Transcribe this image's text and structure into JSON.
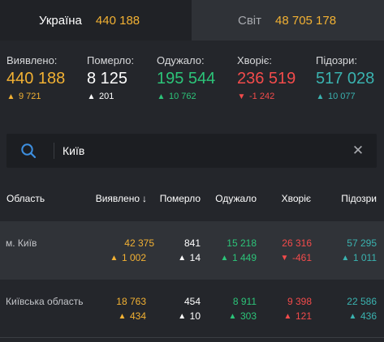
{
  "tabs": {
    "ukraine": {
      "label": "Україна",
      "value": "440 188"
    },
    "world": {
      "label": "Світ",
      "value": "48 705 178"
    }
  },
  "stats": [
    {
      "label": "Виявлено:",
      "value": "440 188",
      "delta": "9 721",
      "direction": "up",
      "color": "#f2b133"
    },
    {
      "label": "Померло:",
      "value": "8 125",
      "delta": "201",
      "direction": "up",
      "color": "#ffffff"
    },
    {
      "label": "Одужало:",
      "value": "195 544",
      "delta": "10 762",
      "direction": "up",
      "color": "#2cc479"
    },
    {
      "label": "Хворіє:",
      "value": "236 519",
      "delta": "-1 242",
      "direction": "down",
      "color": "#f34b4b"
    },
    {
      "label": "Підозри:",
      "value": "517 028",
      "delta": "10 077",
      "direction": "up",
      "color": "#3ab3b0"
    }
  ],
  "search": {
    "value": "Київ",
    "icon": "search-icon",
    "clear_icon": "close-icon"
  },
  "table": {
    "headers": {
      "region": "Область",
      "confirmed": "Виявлено",
      "deaths": "Померло",
      "recovered": "Одужало",
      "sick": "Хворіє",
      "suspected": "Підозри"
    },
    "sort_indicator": "↓",
    "rows": [
      {
        "region": "м. Київ",
        "confirmed": {
          "value": "42 375",
          "delta": "1 002"
        },
        "deaths": {
          "value": "841",
          "delta": "14"
        },
        "recovered": {
          "value": "15 218",
          "delta": "1 449"
        },
        "sick": {
          "value": "26 316",
          "delta": "-461"
        },
        "suspected": {
          "value": "57 295",
          "delta": "1 011"
        }
      },
      {
        "region": "Київська область",
        "confirmed": {
          "value": "18 763",
          "delta": "434"
        },
        "deaths": {
          "value": "454",
          "delta": "10"
        },
        "recovered": {
          "value": "8 911",
          "delta": "303"
        },
        "sick": {
          "value": "9 398",
          "delta": "121"
        },
        "suspected": {
          "value": "22 586",
          "delta": "436"
        }
      }
    ]
  },
  "colors": {
    "confirmed": "#f2b133",
    "deaths": "#ffffff",
    "recovered": "#2cc479",
    "sick": "#f34b4b",
    "suspected": "#3ab3b0"
  }
}
